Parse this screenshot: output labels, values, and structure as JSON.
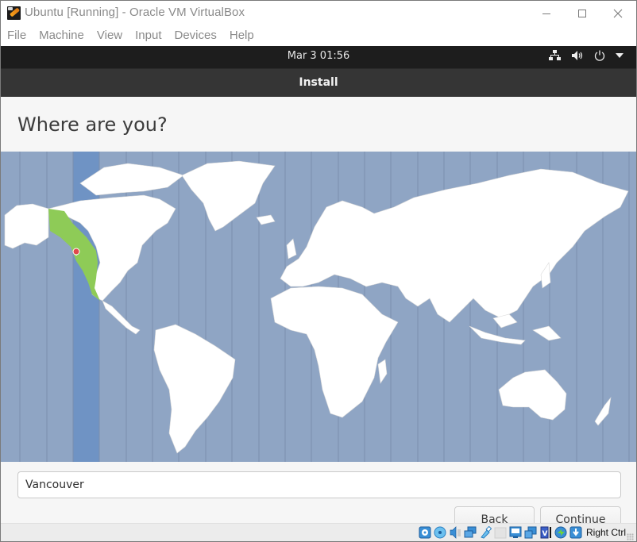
{
  "window": {
    "title": "Ubuntu [Running] - Oracle VM VirtualBox",
    "controls": [
      "minimize",
      "maximize",
      "close"
    ]
  },
  "menubar": {
    "items": [
      "File",
      "Machine",
      "View",
      "Input",
      "Devices",
      "Help"
    ]
  },
  "guest_panel": {
    "clock": "Mar 3  01:56",
    "tray_icons": [
      "network-icon",
      "volume-icon",
      "power-icon",
      "dropdown-arrow-icon"
    ]
  },
  "installer": {
    "header_title": "Install",
    "page_heading": "Where are you?",
    "map": {
      "selected_city": "Vancouver",
      "selected_timezone_highlight": "America/Vancouver (UTC-8)",
      "colors": {
        "ocean": "#8fa5c4",
        "land": "#ffffff",
        "selected_band": "#6f93c4",
        "selected_region": "#8ecb57",
        "pin": "#e0494b"
      }
    },
    "location_field": {
      "value": "Vancouver"
    },
    "buttons": {
      "back": "Back",
      "continue": "Continue"
    }
  },
  "statusbar": {
    "icons": [
      "hard-disk-icon",
      "optical-drive-icon",
      "audio-icon",
      "network-adapters-icon",
      "usb-icon",
      "shared-folders-icon",
      "display-icon",
      "video-capture-icon",
      "virtualization-icon",
      "mouse-integration-icon",
      "keyboard-capture-icon"
    ],
    "host_key": "Right Ctrl"
  }
}
